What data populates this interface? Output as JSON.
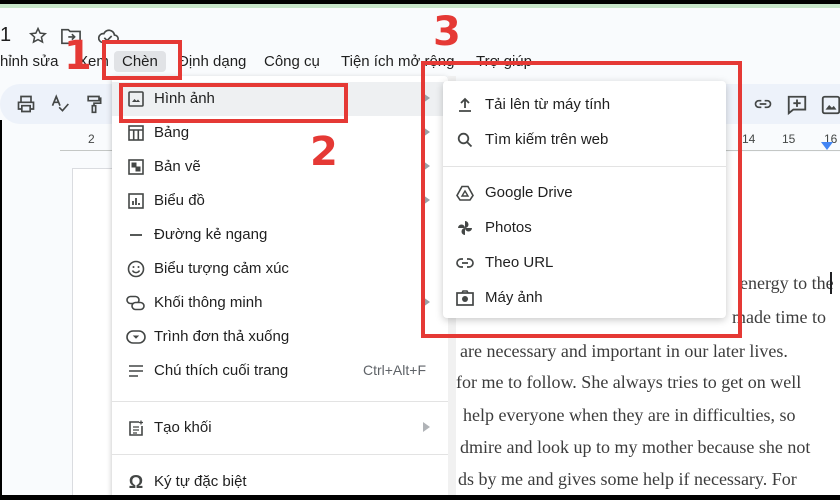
{
  "titlebar": {
    "doc_title_fragment": "1",
    "icons": [
      "star-icon",
      "move-to-folder-icon",
      "cloud-status-icon"
    ]
  },
  "menubar": {
    "items": [
      {
        "label": "hỉnh sửa"
      },
      {
        "label": "Xem"
      },
      {
        "label": "Chèn",
        "active": true
      },
      {
        "label": "Định dạng"
      },
      {
        "label": "Công cụ"
      },
      {
        "label": "Tiện ích mở rộng"
      },
      {
        "label": "Trợ giúp"
      }
    ]
  },
  "toolbar": {
    "left_icons": [
      "print-icon",
      "spellcheck-icon",
      "paint-format-icon"
    ],
    "right_icons": [
      "link-icon",
      "add-comment-icon",
      "insert-image-icon"
    ]
  },
  "ruler": {
    "labels": [
      "2",
      "14",
      "15",
      "16"
    ]
  },
  "insert_menu": {
    "items": [
      {
        "label": "Hình ảnh",
        "icon": "image-icon",
        "submenu": true,
        "highlighted": true
      },
      {
        "label": "Bảng",
        "icon": "table-icon",
        "submenu": true
      },
      {
        "label": "Bản vẽ",
        "icon": "drawing-icon",
        "submenu": true
      },
      {
        "label": "Biểu đồ",
        "icon": "chart-icon",
        "submenu": true
      },
      {
        "label": "Đường kẻ ngang",
        "icon": "horizontal-line-icon"
      },
      {
        "label": "Biểu tượng cảm xúc",
        "icon": "emoji-icon"
      },
      {
        "label": "Khối thông minh",
        "icon": "smart-chips-icon",
        "submenu": true
      },
      {
        "label": "Trình đơn thả xuống",
        "icon": "dropdown-icon"
      },
      {
        "label": "Chú thích cuối trang",
        "icon": "footnote-icon",
        "shortcut": "Ctrl+Alt+F"
      },
      {
        "label": "Tạo khối",
        "icon": "building-blocks-icon",
        "submenu": true
      },
      {
        "label": "Ký tự đặc biệt",
        "icon": "omega-icon"
      }
    ]
  },
  "image_submenu": {
    "items": [
      {
        "label": "Tải lên từ máy tính",
        "icon": "upload-icon"
      },
      {
        "label": "Tìm kiếm trên web",
        "icon": "search-icon"
      },
      {
        "label": "Google Drive",
        "icon": "google-drive-icon"
      },
      {
        "label": "Photos",
        "icon": "photos-pinwheel-icon"
      },
      {
        "label": "Theo URL",
        "icon": "link-icon"
      },
      {
        "label": "Máy ảnh",
        "icon": "camera-icon"
      }
    ]
  },
  "document": {
    "lines": [
      "energy to the",
      "made time to",
      "are necessary and important in our later lives.",
      "for me to follow. She always tries to get on well",
      "help everyone when they are in difficulties, so",
      "dmire and look up to my mother because she not",
      "ds by me and gives some help if necessary. For"
    ]
  },
  "annotations": {
    "step1": "1",
    "step2": "2",
    "step3": "3",
    "color": "#e53935"
  }
}
